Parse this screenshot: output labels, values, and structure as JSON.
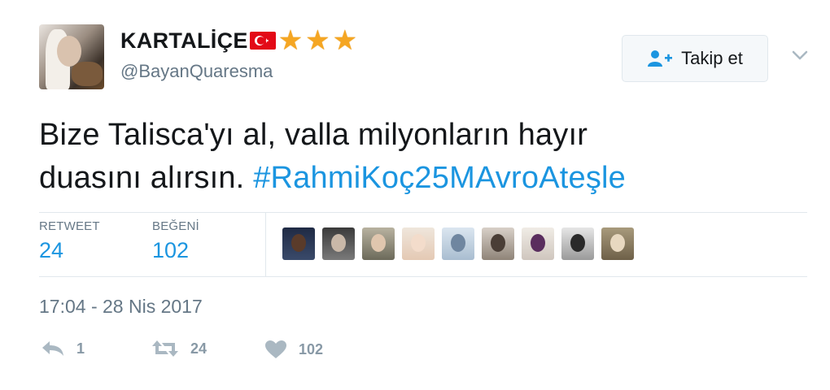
{
  "tweet": {
    "author": {
      "display_name": "KARTALİÇE",
      "handle": "@BayanQuaresma"
    },
    "follow_button": {
      "label": "Takip et"
    },
    "text_part1": "Bize Talisca'yı al, valla milyonların hayır",
    "text_part2": "duasını alırsın. ",
    "hashtag": "#RahmiKoç25MAvroAteşle",
    "stats": {
      "retweet_label": "RETWEET",
      "retweet_count": "24",
      "like_label": "BEĞENİ",
      "like_count": "102"
    },
    "timestamp": "17:04 - 28 Nis 2017",
    "actions": {
      "reply_count": "1",
      "retweet_count": "24",
      "like_count": "102"
    }
  },
  "colors": {
    "link_blue": "#1b95e0",
    "star_gold": "#f5a623",
    "flag_red": "#e30a17",
    "muted_text": "#657786"
  },
  "icons": [
    "turkey-flag-icon",
    "star-icon",
    "add-user-icon",
    "chevron-down-icon",
    "reply-icon",
    "retweet-icon",
    "heart-icon"
  ]
}
